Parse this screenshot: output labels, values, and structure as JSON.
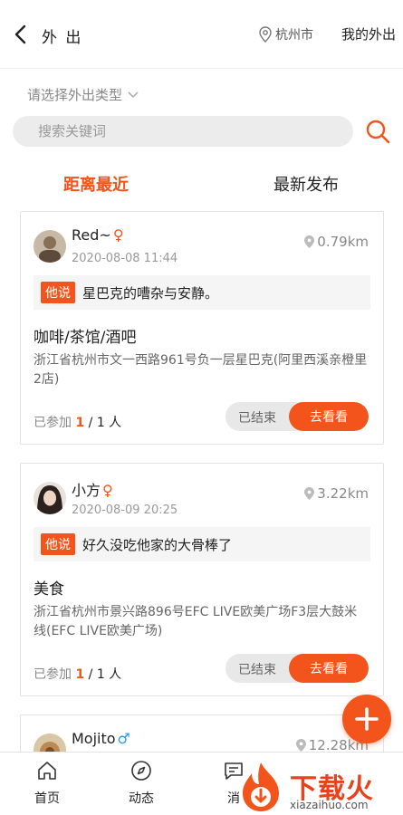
{
  "header": {
    "title": "外 出",
    "location": "杭州市",
    "my_out": "我的外出"
  },
  "type_select": {
    "label": "请选择外出类型"
  },
  "search": {
    "placeholder": "搜索关键词"
  },
  "tabs": [
    {
      "label": "距离最近",
      "active": true
    },
    {
      "label": "最新发布",
      "active": false
    }
  ],
  "posts": [
    {
      "name": "Red~",
      "gender": "♀",
      "time": "2020-08-08 11:44",
      "distance": "0.79km",
      "says_tag": "他说",
      "says": "星巴克的嘈杂与安静。",
      "category": "咖啡/茶馆/酒吧",
      "address": "浙江省杭州市文一西路961号负一层星巴克(阿里西溪亲橙里2店)",
      "joined_prefix": "已参加",
      "joined_count": "1",
      "joined_total": "/ 1 人",
      "status": "已结束",
      "action": "去看看"
    },
    {
      "name": "小方",
      "gender": "♀",
      "time": "2020-08-09 20:25",
      "distance": "3.22km",
      "says_tag": "他说",
      "says": "好久没吃他家的大骨棒了",
      "category": "美食",
      "address": "浙江省杭州市景兴路896号EFC LIVE欧美广场F3层大鼓米线(EFC LIVE欧美广场)",
      "joined_prefix": "已参加",
      "joined_count": "1",
      "joined_total": "/ 1 人",
      "status": "已结束",
      "action": "去看看"
    },
    {
      "name": "Mojito",
      "gender": "♂",
      "distance": "12.28km"
    }
  ],
  "nav": [
    {
      "label": "首页"
    },
    {
      "label": "动态"
    },
    {
      "label": "消"
    }
  ],
  "watermark": {
    "text": "下载火",
    "url": "xiazaihuo.com"
  },
  "colors": {
    "accent": "#f2541b",
    "male": "#2f9be8"
  }
}
